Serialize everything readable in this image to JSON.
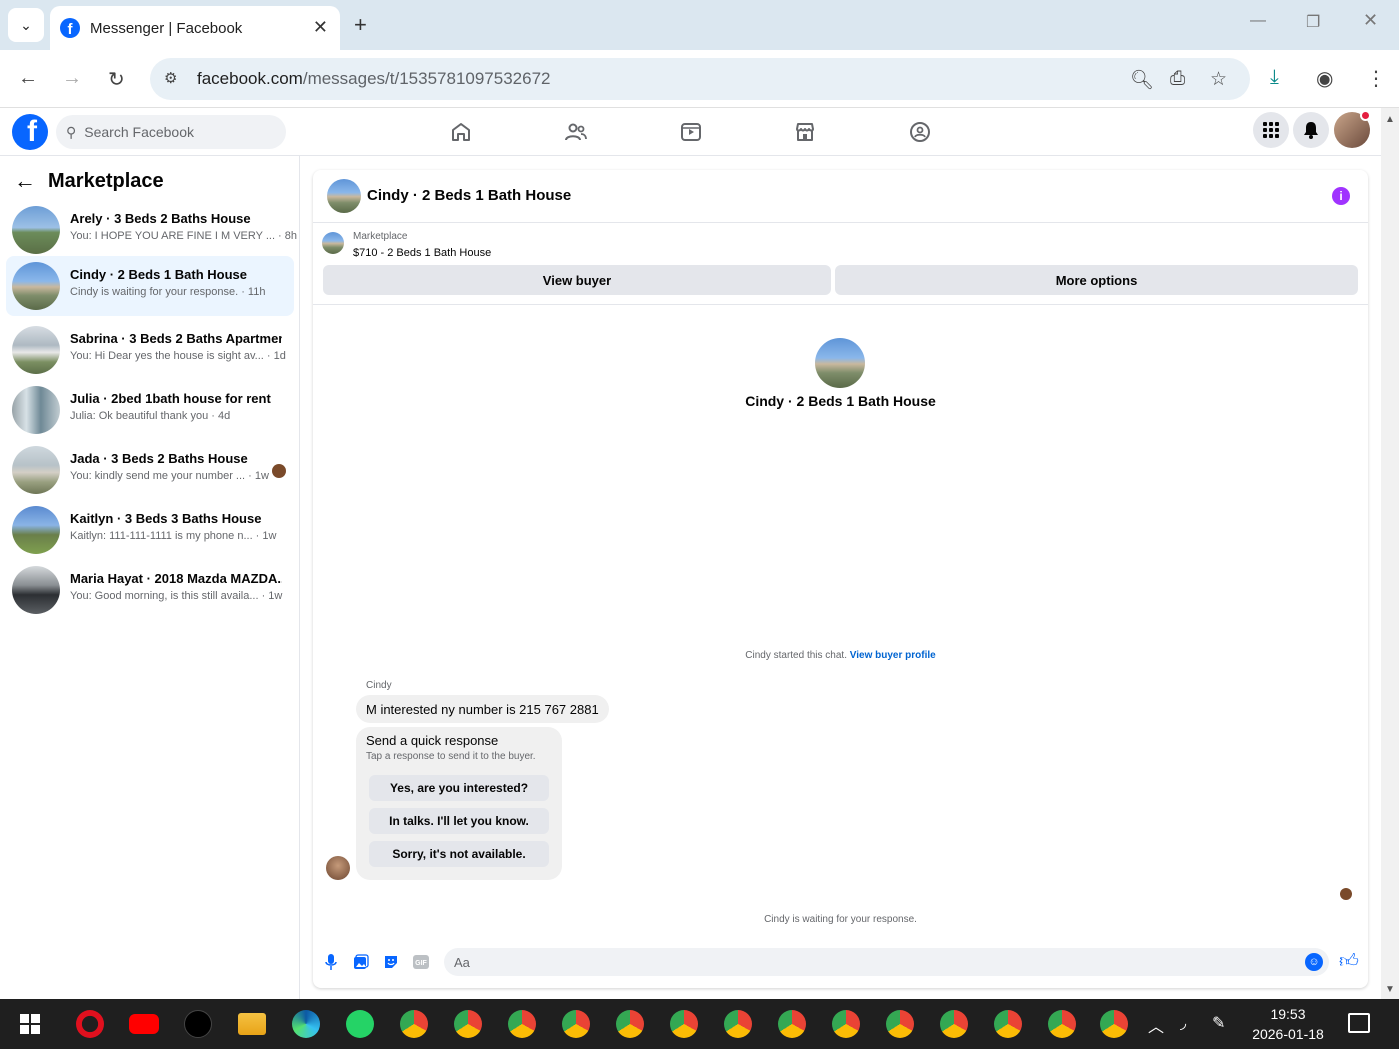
{
  "browser": {
    "tab_title": "Messenger | Facebook",
    "url_host": "facebook.com",
    "url_path": "/messages/t/1535781097532672"
  },
  "facebook": {
    "search_placeholder": "Search Facebook"
  },
  "sidebar": {
    "title": "Marketplace",
    "conversations": [
      {
        "name": "Arely · 3 Beds 2 Baths House",
        "snippet": "You: I HOPE YOU ARE FINE I M VERY ... · 8h",
        "active": false
      },
      {
        "name": "Cindy · 2 Beds 1 Bath House",
        "snippet": "Cindy is waiting for your response. · 11h",
        "active": true
      },
      {
        "name": "Sabrina · 3 Beds 2 Baths Apartmen...",
        "snippet": "You: Hi Dear yes the house is sight av... · 1d",
        "active": false
      },
      {
        "name": "Julia · 2bed 1bath house for rent",
        "snippet": "Julia: Ok beautiful thank you · 4d",
        "active": false
      },
      {
        "name": "Jada · 3 Beds 2 Baths House",
        "snippet": "You: kindly send me your number ... · 1w",
        "active": false
      },
      {
        "name": "Kaitlyn · 3 Beds 3 Baths House",
        "snippet": "Kaitlyn: 111-111-1111 is my phone n... · 1w",
        "active": false
      },
      {
        "name": "Maria Hayat · 2018 Mazda MAZDA...",
        "snippet": "You: Good morning, is this still availa... · 1w",
        "active": false
      }
    ]
  },
  "chat": {
    "title": "Cindy · 2 Beds 1 Bath House",
    "marketplace_label": "Marketplace",
    "listing": "$710 - 2 Beds 1 Bath House",
    "view_buyer": "View buyer",
    "more_options": "More options",
    "hero_name": "Cindy · 2 Beds 1 Bath House",
    "started_text": "Cindy started this chat. ",
    "view_profile_link": "View buyer profile",
    "sender_name": "Cindy",
    "message": "M interested ny number is 215 767 2881",
    "quick_title": "Send a quick response",
    "quick_subtitle": "Tap a response to send it to the buyer.",
    "quick_replies": [
      "Yes, are you interested?",
      "In talks. I'll let you know.",
      "Sorry, it's not available."
    ],
    "waiting_text": "Cindy is waiting for your response.",
    "composer_placeholder": "Aa"
  },
  "taskbar": {
    "time": "19:53",
    "date": "2026-01-18"
  },
  "colors": {
    "fb_blue": "#0866ff",
    "active_conv_bg": "#ebf5ff",
    "info_purple": "#a033ff"
  }
}
